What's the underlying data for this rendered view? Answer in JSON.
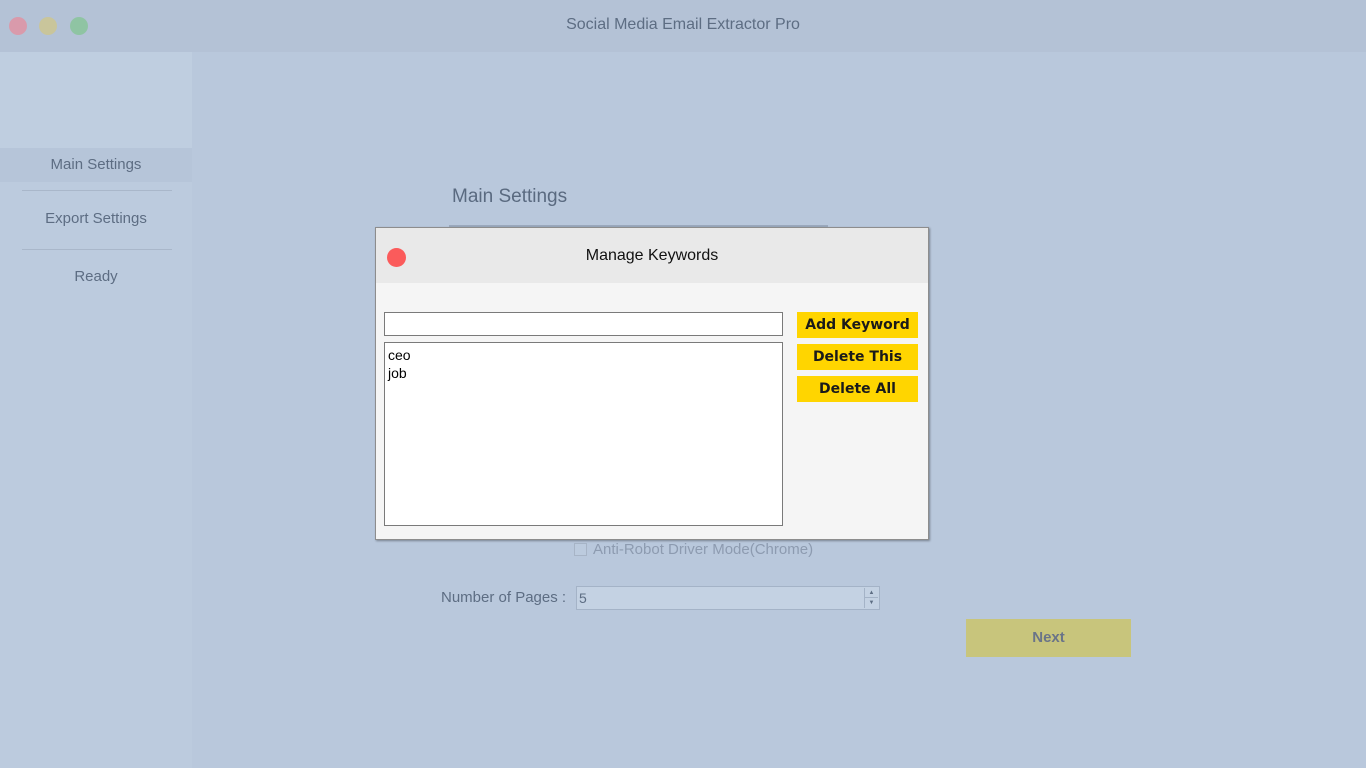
{
  "window": {
    "title": "Social Media Email Extractor Pro"
  },
  "sidebar": {
    "items": [
      {
        "label": "Main Settings"
      },
      {
        "label": "Export Settings"
      },
      {
        "label": "Ready"
      }
    ]
  },
  "main": {
    "heading": "Main Settings",
    "anti_robot_label": "Anti-Robot Driver Mode(Chrome)",
    "pages_label": "Number of Pages :",
    "pages_value": "5",
    "next_label": "Next"
  },
  "dialog": {
    "title": "Manage Keywords",
    "input_value": "",
    "keywords": [
      "ceo",
      "job"
    ],
    "add_label": "Add Keyword",
    "delete_label": "Delete This",
    "delete_all_label": "Delete All"
  },
  "colors": {
    "background": "#b9c8dc",
    "dialog_button": "#ffd500",
    "close_button": "#fb5b5b",
    "next_button": "#c8c57c"
  }
}
